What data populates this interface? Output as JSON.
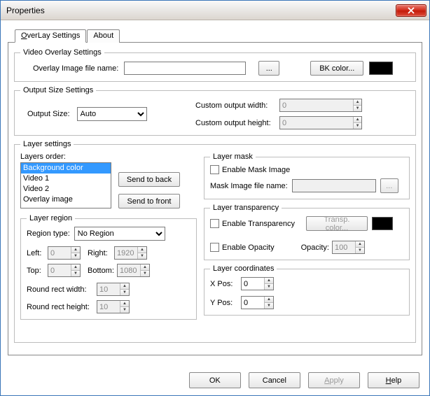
{
  "window": {
    "title": "Properties"
  },
  "tabs": {
    "overlay": "OverLay Settings",
    "about": "About"
  },
  "video_overlay": {
    "legend": "Video Overlay Settings",
    "image_name_label": "Overlay Image file name:",
    "image_name_value": "",
    "browse": "...",
    "bk_color_btn": "BK color...",
    "bk_color_hex": "#000000"
  },
  "output_size": {
    "legend": "Output Size Settings",
    "output_size_label": "Output Size:",
    "output_size_value": "Auto",
    "custom_width_label": "Custom output width:",
    "custom_width_value": "0",
    "custom_height_label": "Custom output height:",
    "custom_height_value": "0"
  },
  "layer_settings": {
    "legend": "Layer settings",
    "layers_order_label": "Layers order:",
    "layers": {
      "bg": "Background color",
      "v1": "Video 1",
      "v2": "Video 2",
      "ov": "Overlay image"
    },
    "send_back": "Send to back",
    "send_front": "Send to front"
  },
  "layer_region": {
    "legend": "Layer region",
    "region_type_label": "Region type:",
    "region_type_value": "No Region",
    "left_label": "Left:",
    "left_value": "0",
    "right_label": "Right:",
    "right_value": "1920",
    "top_label": "Top:",
    "top_value": "0",
    "bottom_label": "Bottom:",
    "bottom_value": "1080",
    "rrw_label": "Round rect width:",
    "rrw_value": "10",
    "rrh_label": "Round rect height:",
    "rrh_value": "10"
  },
  "layer_mask": {
    "legend": "Layer mask",
    "enable_label": "Enable Mask Image",
    "file_label": "Mask Image file name:",
    "file_value": "",
    "browse": "..."
  },
  "layer_transparency": {
    "legend": "Layer transparency",
    "enable_transp_label": "Enable Transparency",
    "transp_color_btn": "Transp. color...",
    "transp_color_hex": "#000000",
    "enable_opacity_label": "Enable Opacity",
    "opacity_label": "Opacity:",
    "opacity_value": "100"
  },
  "layer_coordinates": {
    "legend": "Layer coordinates",
    "x_label": "X Pos:",
    "x_value": "0",
    "y_label": "Y Pos:",
    "y_value": "0"
  },
  "footer": {
    "ok": "OK",
    "cancel": "Cancel",
    "apply": "Apply",
    "help": "Help"
  }
}
